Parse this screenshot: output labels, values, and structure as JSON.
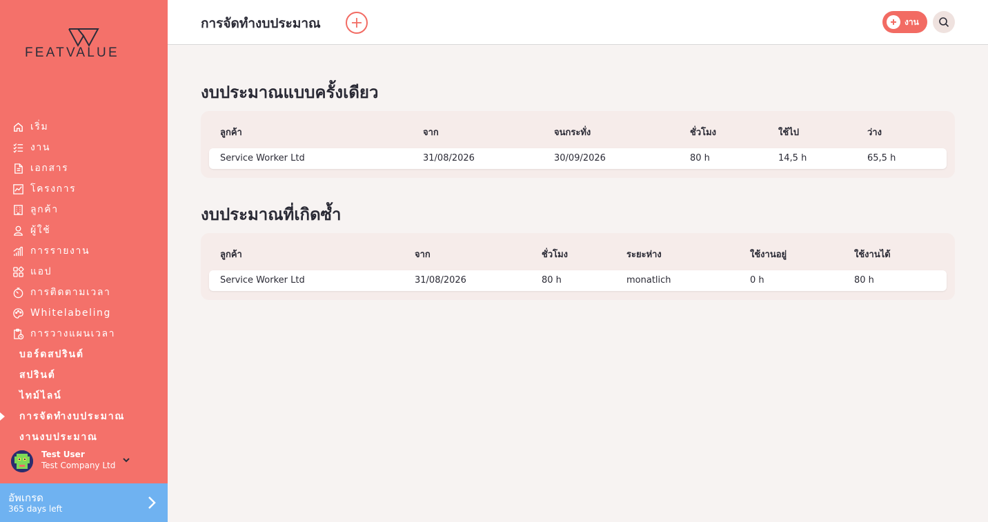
{
  "brand": {
    "logo_text": "FEATVALUE"
  },
  "sidebar": {
    "items": [
      {
        "label": "เริ่ม",
        "icon": "home-icon"
      },
      {
        "label": "งาน",
        "icon": "checklist-icon"
      },
      {
        "label": "เอกสาร",
        "icon": "document-icon"
      },
      {
        "label": "โครงการ",
        "icon": "chart-board-icon"
      },
      {
        "label": "ลูกค้า",
        "icon": "building-icon"
      },
      {
        "label": "ผู้ใช้",
        "icon": "user-icon"
      },
      {
        "label": "การรายงาน",
        "icon": "bar-chart-icon"
      },
      {
        "label": "แอป",
        "icon": "apps-grid-icon"
      },
      {
        "label": "การติดตามเวลา",
        "icon": "stopwatch-icon"
      },
      {
        "label": "Whitelabeling",
        "icon": "palette-icon"
      },
      {
        "label": "การวางแผนเวลา",
        "icon": "clipboard-clock-icon"
      }
    ],
    "sub_items": [
      {
        "label": "บอร์ดสปรินต์"
      },
      {
        "label": "สปรินต์"
      },
      {
        "label": "ไทม์ไลน์"
      },
      {
        "label": "การจัดทำงบประมาณ",
        "active": true
      },
      {
        "label": "งานงบประมาณ"
      }
    ],
    "user": {
      "name": "Test User",
      "company": "Test Company Ltd"
    },
    "upgrade": {
      "title": "อัพเกรด",
      "subtitle": "365 days left"
    }
  },
  "header": {
    "title": "การจัดทำงบประมาณ",
    "task_button_label": "งาน"
  },
  "one_time_budgets": {
    "title": "งบประมาณแบบครั้งเดียว",
    "columns": [
      "ลูกค้า",
      "จาก",
      "จนกระทั่ง",
      "ชั่วโมง",
      "ใช้ไป",
      "ว่าง"
    ],
    "rows": [
      [
        "Service Worker Ltd",
        "31/08/2026",
        "30/09/2026",
        "80 h",
        "14,5 h",
        "65,5 h"
      ]
    ]
  },
  "recurring_budgets": {
    "title": "งบประมาณที่เกิดซ้ำ",
    "columns": [
      "ลูกค้า",
      "จาก",
      "ชั่วโมง",
      "ระยะห่าง",
      "ใช้งานอยู่",
      "ใช้งานได้"
    ],
    "rows": [
      [
        "Service Worker Ltd",
        "31/08/2026",
        "80 h",
        "monatlich",
        "0 h",
        "80 h"
      ]
    ]
  },
  "colors": {
    "sidebar_bg": "#f4716a",
    "accent": "#f26b63",
    "upgrade_bg": "#6fb2f1",
    "page_bg": "#f7f3f2",
    "card_bg": "#f6ecea"
  }
}
